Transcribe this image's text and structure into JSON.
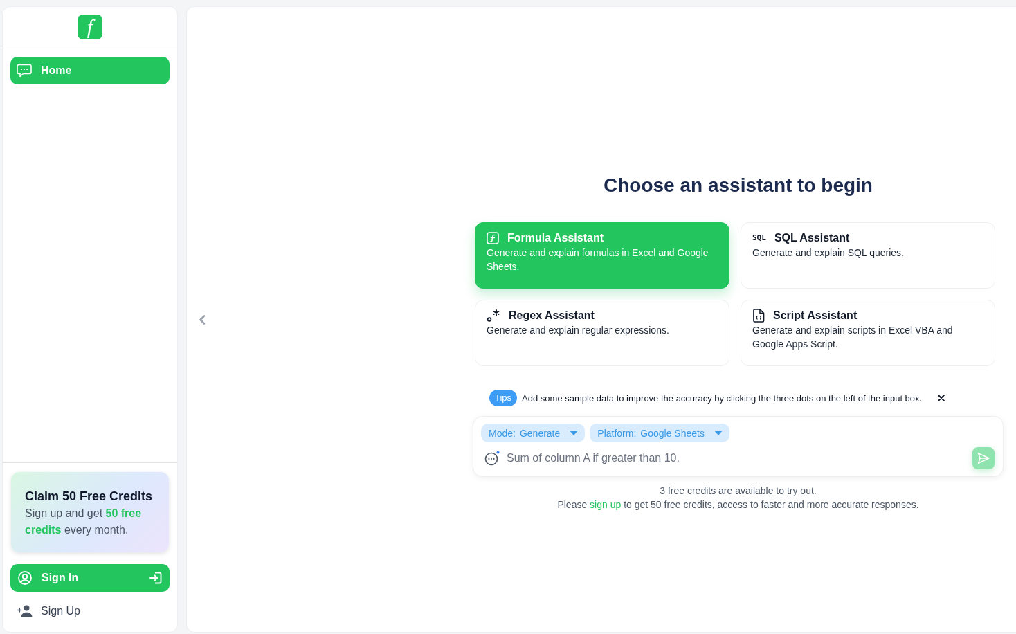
{
  "sidebar": {
    "logo": {
      "letter": "f"
    },
    "nav": [
      {
        "label": "Home",
        "selected": true
      }
    ],
    "promo": {
      "title": "Claim 50 Free Credits",
      "text": "Sign up and get **50 free credits** every month."
    },
    "sign_in": {
      "label": "Sign In"
    },
    "sign_up": {
      "label": "Sign Up"
    }
  },
  "main": {
    "heading": "Choose an assistant to begin",
    "assistants": [
      {
        "kind": "formula",
        "title": "Formula Assistant",
        "description": "Generate and explain formulas in Excel and Google Sheets.",
        "selected": true
      },
      {
        "kind": "sql",
        "icon_text": "SQL",
        "title": "SQL Assistant",
        "description": "Generate and explain SQL queries.",
        "selected": false
      },
      {
        "kind": "regex",
        "title": "Regex Assistant",
        "description": "Generate and explain regular expressions.",
        "selected": false
      },
      {
        "kind": "script",
        "title": "Script Assistant",
        "description": "Generate and explain scripts in Excel VBA and Google Apps Script.",
        "selected": false
      }
    ],
    "tip": {
      "badge": "Tips",
      "text": "Add some sample data to improve the accuracy by clicking the three dots on the left of the input box."
    },
    "composer": {
      "chips": [
        {
          "label": "Mode:",
          "value": "Generate"
        },
        {
          "label": "Platform:",
          "value": "Google Sheets"
        }
      ],
      "input": {
        "placeholder": "Sum of column A if greater than 10."
      },
      "send": {
        "disabled": true
      }
    },
    "footer": {
      "line": "3 free credits are available to try out.",
      "notice": {
        "before": "Please",
        "link": "sign up",
        "after": "to get 50 free credits, access to faster and more accurate responses."
      }
    }
  }
}
